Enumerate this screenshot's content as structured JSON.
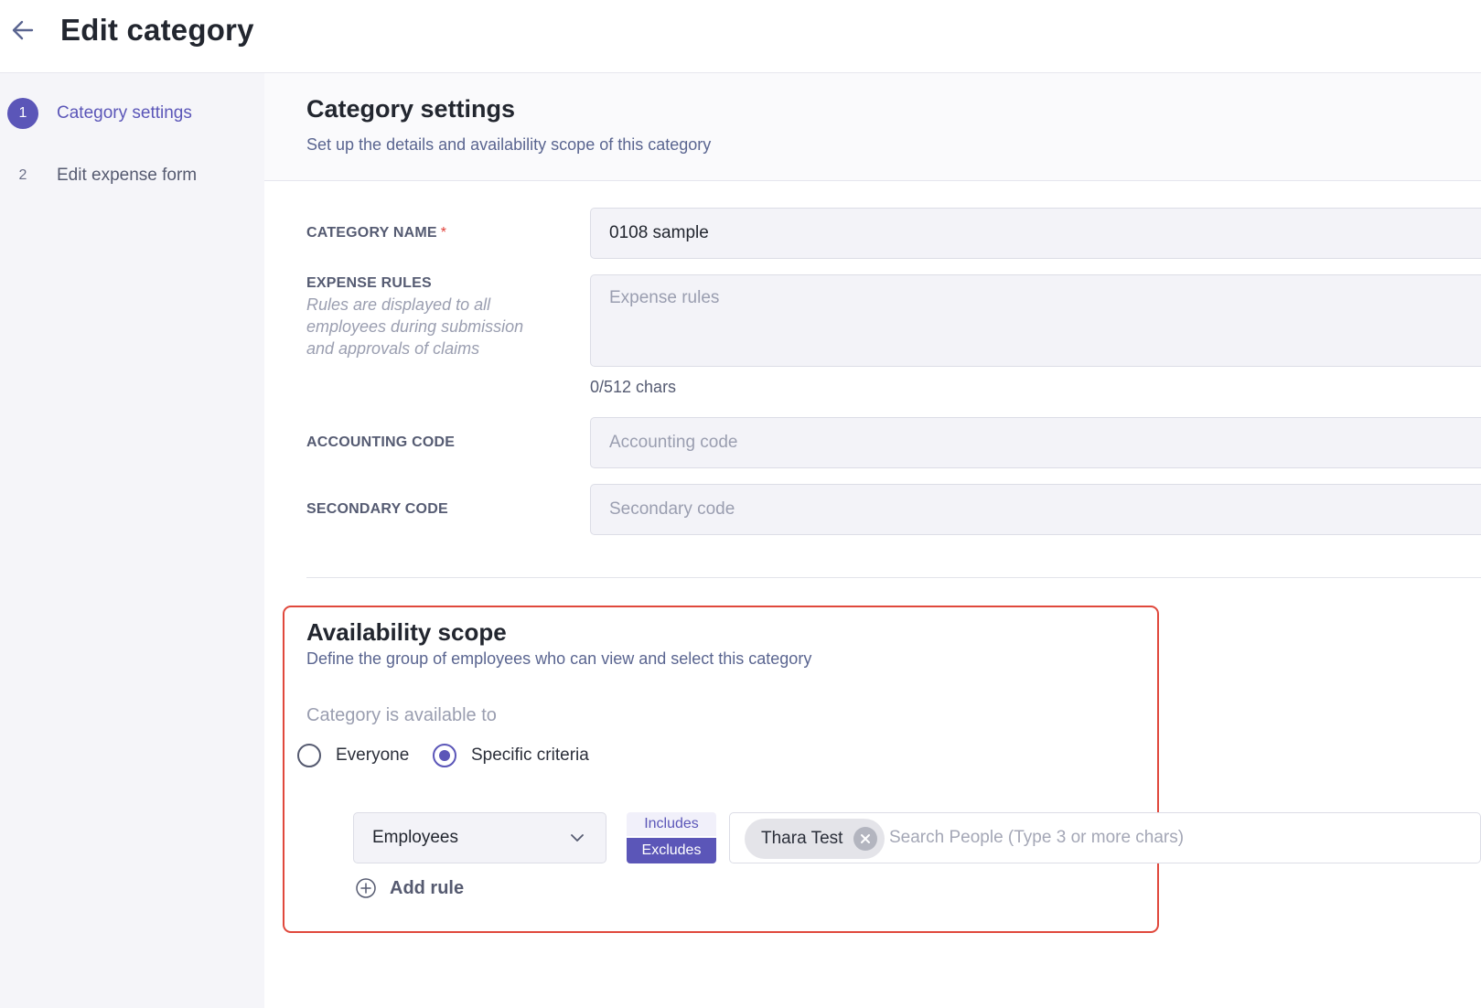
{
  "header": {
    "title": "Edit category"
  },
  "sidebar": {
    "steps": [
      {
        "number": "1",
        "label": "Category settings"
      },
      {
        "number": "2",
        "label": "Edit expense form"
      }
    ]
  },
  "section": {
    "title": "Category settings",
    "subtitle": "Set up the details and availability scope of this category"
  },
  "fields": {
    "category_name": {
      "label": "CATEGORY NAME",
      "required_mark": "*",
      "value": "0108 sample"
    },
    "expense_rules": {
      "label": "EXPENSE RULES",
      "help": "Rules are displayed to all employees during submission and approvals of claims",
      "placeholder": "Expense rules",
      "char_count": "0/512 chars"
    },
    "accounting_code": {
      "label": "ACCOUNTING CODE",
      "placeholder": "Accounting code"
    },
    "secondary_code": {
      "label": "SECONDARY CODE",
      "placeholder": "Secondary code"
    }
  },
  "scope": {
    "title": "Availability scope",
    "subtitle": "Define the group of employees who can view and select this category",
    "available_label": "Category is available to",
    "options": {
      "everyone": "Everyone",
      "specific": "Specific criteria"
    },
    "selected": "specific",
    "rule": {
      "type": "Employees",
      "include_label": "Includes",
      "exclude_label": "Excludes",
      "mode": "Excludes",
      "chips": [
        "Thara Test"
      ],
      "search_placeholder": "Search People (Type 3 or more chars)"
    },
    "add_rule_label": "Add rule"
  },
  "colors": {
    "accent": "#5b56b8",
    "highlight_border": "#e0483c"
  }
}
